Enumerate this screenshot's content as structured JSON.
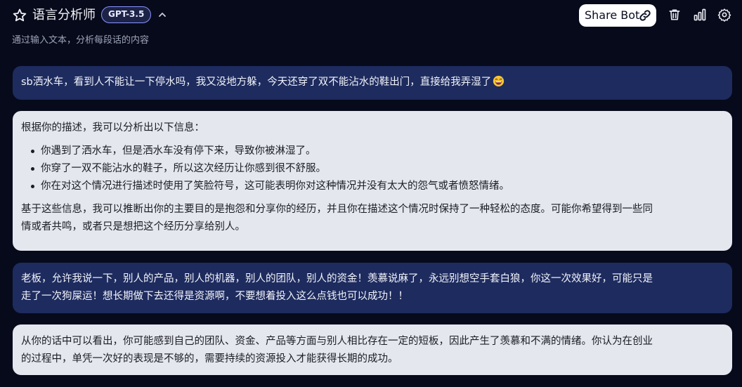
{
  "header": {
    "bot_name": "语言分析师",
    "model": "GPT-3.5",
    "share_label": "Share Bot",
    "description": "通过输入文本，分析每段话的内容"
  },
  "messages": [
    {
      "role": "user",
      "text": "sb洒水车，看到人不能让一下停水吗，我又没地方躲，今天还穿了双不能沾水的鞋出门，直接给我弄湿了"
    },
    {
      "role": "bot",
      "intro": "根据你的描述，我可以分析出以下信息：",
      "bullets": [
        "你遇到了洒水车，但是洒水车没有停下来，导致你被淋湿了。",
        "你穿了一双不能沾水的鞋子，所以这次经历让你感到很不舒服。",
        "你在对这个情况进行描述时使用了笑脸符号，这可能表明你对这种情况并没有太大的怨气或者愤怒情绪。"
      ],
      "conclusion_line1": "基于这些信息，我可以推断出你的主要目的是抱怨和分享你的经历，并且你在描述这个情况时保持了一种轻松的态度。可能你希望得到一些同",
      "conclusion_line2": "情或者共鸣，或者只是想把这个经历分享给别人。"
    },
    {
      "role": "user",
      "line1": "老板，允许我说一下，别人的产品，别人的机器，别人的团队，别人的资金！羡慕说麻了，永远别想空手套白狼，你这一次效果好，可能只是",
      "line2": "走了一次狗屎运！想长期做下去还得是资源啊，不要想着投入这么点钱也可以成功！！"
    },
    {
      "role": "bot",
      "line1": "从你的话中可以看出，你可能感到自己的团队、资金、产品等方面与别人相比存在一定的短板，因此产生了羡慕和不满的情绪。你认为在创业",
      "line2": "的过程中，单凭一次好的表现是不够的，需要持续的资源投入才能获得长期的成功。"
    }
  ],
  "icons": {
    "favorite": "star-icon",
    "collapse": "chevron-up-icon",
    "share": "link-icon",
    "delete": "trash-icon",
    "stats": "bar-chart-icon",
    "settings": "gear-icon",
    "emoji": "grinning-sweat-emoji"
  },
  "colors": {
    "background": "#070a1b",
    "user_bubble": "#1e2b5e",
    "bot_bubble": "#e5e7ee",
    "badge_border": "#8a94ff"
  }
}
